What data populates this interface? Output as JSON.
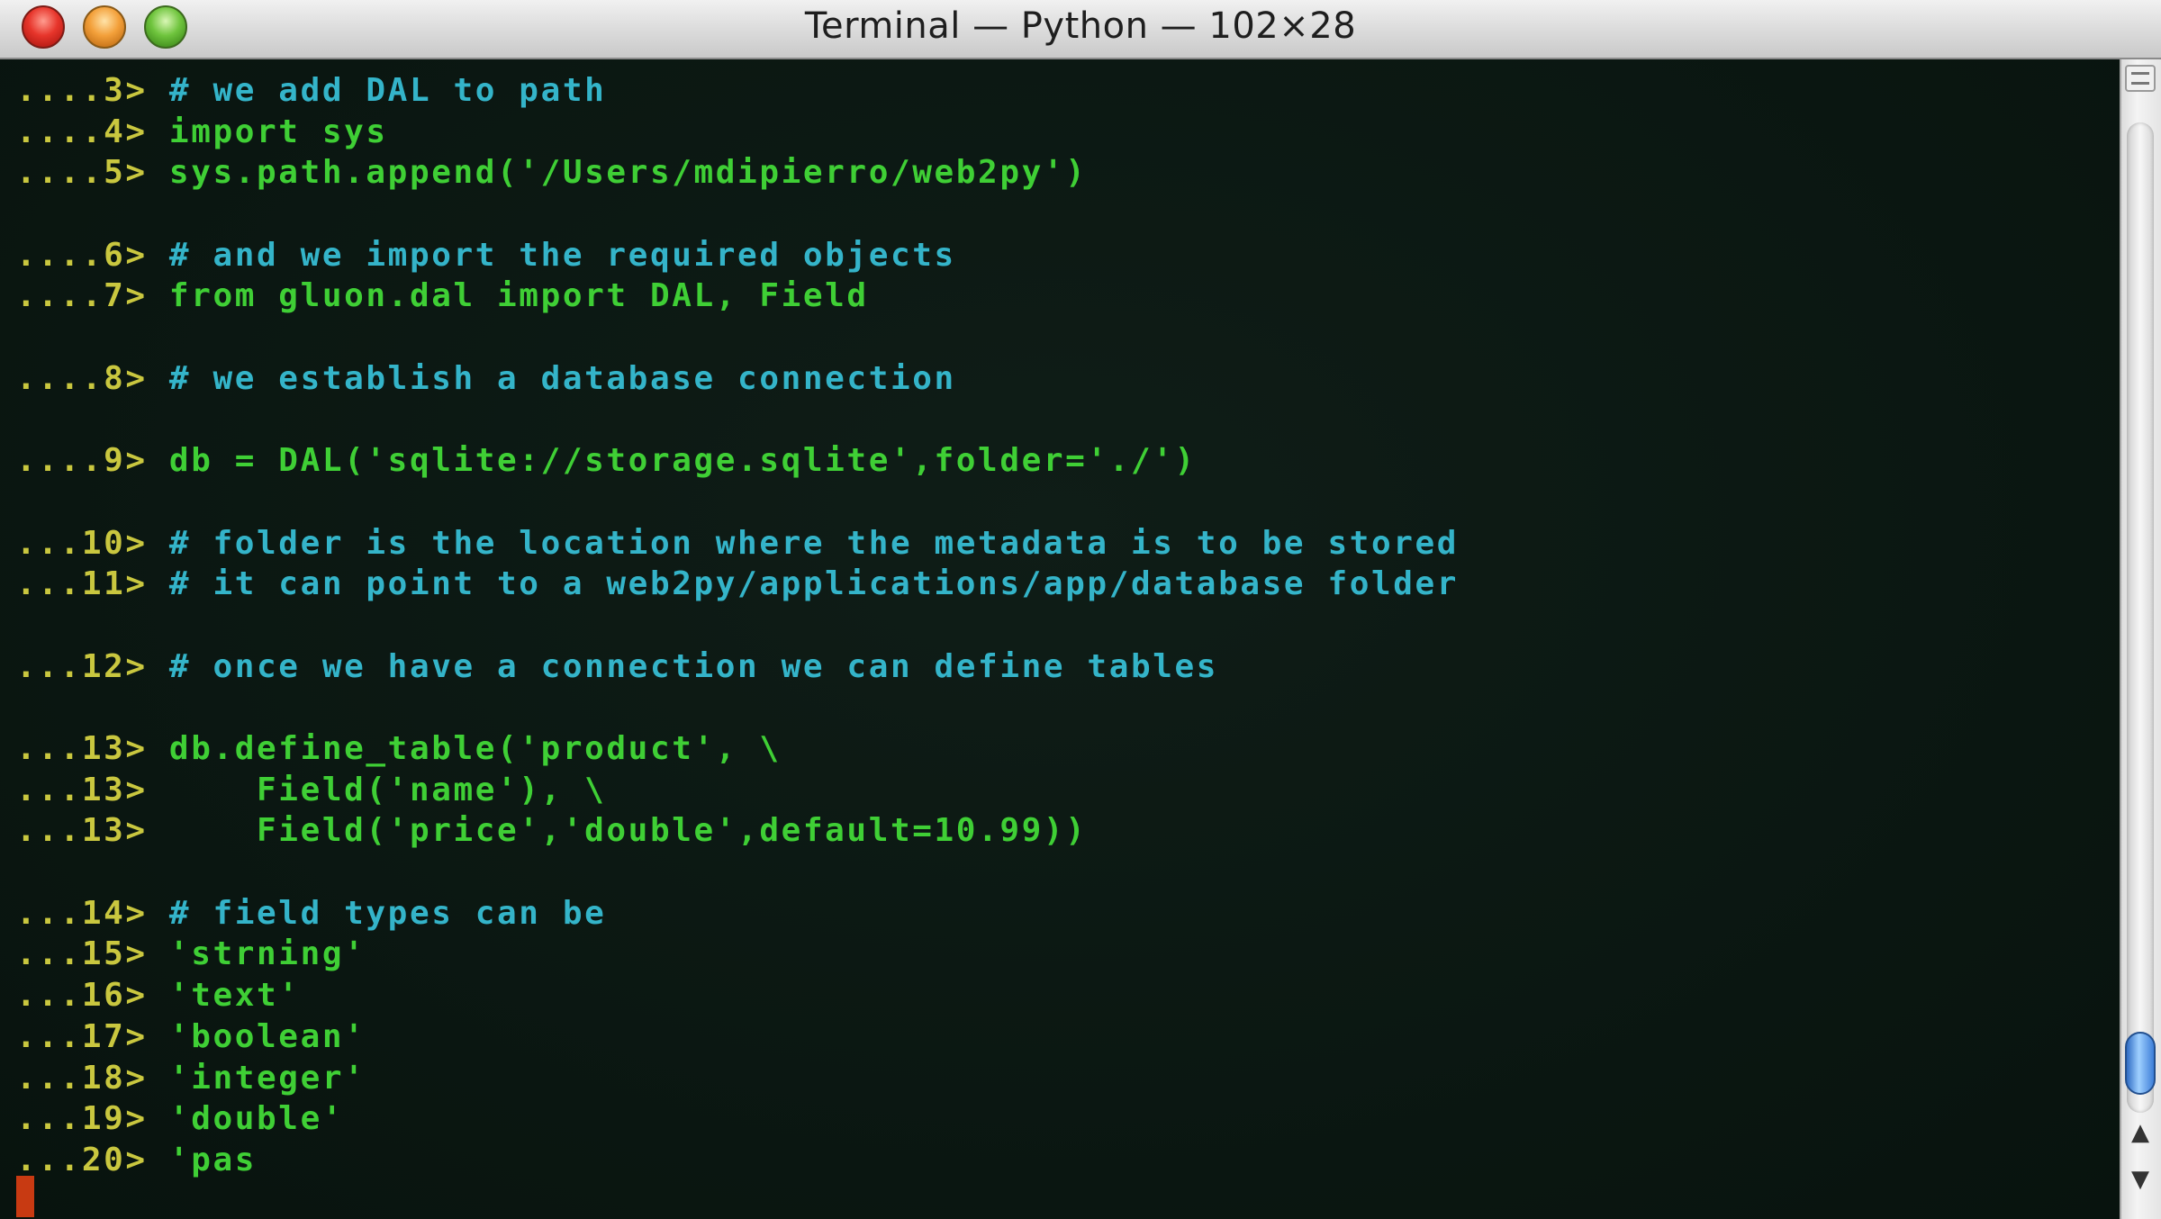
{
  "window": {
    "title": "Terminal — Python — 102×28",
    "buttons": [
      {
        "name": "close-button",
        "icon": "close-icon",
        "color": "#e7352b"
      },
      {
        "name": "minimize-button",
        "icon": "minimize-icon",
        "color": "#f3a03a"
      },
      {
        "name": "zoom-button",
        "icon": "zoom-icon",
        "color": "#6fc43d"
      }
    ]
  },
  "colors": {
    "background": "#0b1712",
    "prompt": "#c9c73f",
    "code": "#3fcf35",
    "comment": "#34b4c9",
    "cursor": "#c83a12"
  },
  "terminal": {
    "lines": [
      {
        "prompt": "....3>",
        "text": " # we add DAL to path",
        "kind": "comment"
      },
      {
        "prompt": "....4>",
        "text": " import sys",
        "kind": "code"
      },
      {
        "prompt": "....5>",
        "text": " sys.path.append('/Users/mdipierro/web2py')",
        "kind": "code"
      },
      {
        "prompt": "",
        "text": "",
        "kind": "blank"
      },
      {
        "prompt": "....6>",
        "text": " # and we import the required objects",
        "kind": "comment"
      },
      {
        "prompt": "....7>",
        "text": " from gluon.dal import DAL, Field",
        "kind": "code"
      },
      {
        "prompt": "",
        "text": "",
        "kind": "blank"
      },
      {
        "prompt": "....8>",
        "text": " # we establish a database connection",
        "kind": "comment"
      },
      {
        "prompt": "",
        "text": "",
        "kind": "blank"
      },
      {
        "prompt": "....9>",
        "text": " db = DAL('sqlite://storage.sqlite',folder='./')",
        "kind": "code"
      },
      {
        "prompt": "",
        "text": "",
        "kind": "blank"
      },
      {
        "prompt": "...10>",
        "text": " # folder is the location where the metadata is to be stored",
        "kind": "comment"
      },
      {
        "prompt": "...11>",
        "text": " # it can point to a web2py/applications/app/database folder",
        "kind": "comment"
      },
      {
        "prompt": "",
        "text": "",
        "kind": "blank"
      },
      {
        "prompt": "...12>",
        "text": " # once we have a connection we can define tables",
        "kind": "comment"
      },
      {
        "prompt": "",
        "text": "",
        "kind": "blank"
      },
      {
        "prompt": "...13>",
        "text": " db.define_table('product', \\",
        "kind": "code"
      },
      {
        "prompt": "...13>",
        "text": "     Field('name'), \\",
        "kind": "code"
      },
      {
        "prompt": "...13>",
        "text": "     Field('price','double',default=10.99))",
        "kind": "code"
      },
      {
        "prompt": "",
        "text": "",
        "kind": "blank"
      },
      {
        "prompt": "...14>",
        "text": " # field types can be",
        "kind": "comment"
      },
      {
        "prompt": "...15>",
        "text": " 'strning'",
        "kind": "code"
      },
      {
        "prompt": "...16>",
        "text": " 'text'",
        "kind": "code"
      },
      {
        "prompt": "...17>",
        "text": " 'boolean'",
        "kind": "code"
      },
      {
        "prompt": "...18>",
        "text": " 'integer'",
        "kind": "code"
      },
      {
        "prompt": "...19>",
        "text": " 'double'",
        "kind": "code"
      },
      {
        "prompt": "...20>",
        "text": " 'pas",
        "kind": "code"
      }
    ]
  },
  "scrollbar": {
    "thumb_icon": "scroll-thumb",
    "up_icon": "arrow-up-icon",
    "down_icon": "arrow-down-icon",
    "up_glyph": "▲",
    "down_glyph": "▼"
  }
}
